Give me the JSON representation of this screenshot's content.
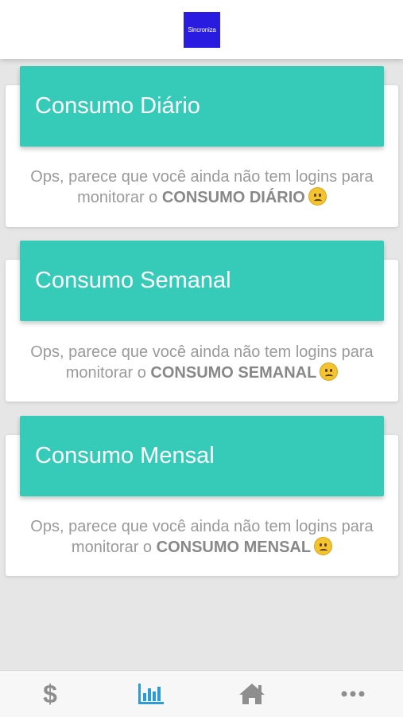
{
  "header": {
    "logo_text": "Sincroniza",
    "logo_color": "#2a1be0"
  },
  "accent_color": "#35cbb8",
  "cards": [
    {
      "title": "Consumo Diário",
      "message_prefix_line1": "Ops, parece que você ainda não tem logins para",
      "message_prefix_line2": "monitorar o",
      "message_strong": "CONSUMO DIÁRIO"
    },
    {
      "title": "Consumo Semanal",
      "message_prefix_line1": "Ops, parece que você ainda não tem logins para",
      "message_prefix_line2": "monitorar o",
      "message_strong": "CONSUMO SEMANAL"
    },
    {
      "title": "Consumo Mensal",
      "message_prefix_line1": "Ops, parece que você ainda não tem logins para",
      "message_prefix_line2": "monitorar o",
      "message_strong": "CONSUMO MENSAL"
    }
  ],
  "bottom_nav": {
    "items": [
      {
        "icon": "dollar-icon",
        "active": false
      },
      {
        "icon": "bar-chart-icon",
        "active": true
      },
      {
        "icon": "home-icon",
        "active": false
      },
      {
        "icon": "more-icon",
        "active": false
      }
    ],
    "active_color": "#2f9bd6",
    "inactive_color": "#8e8e8e"
  }
}
